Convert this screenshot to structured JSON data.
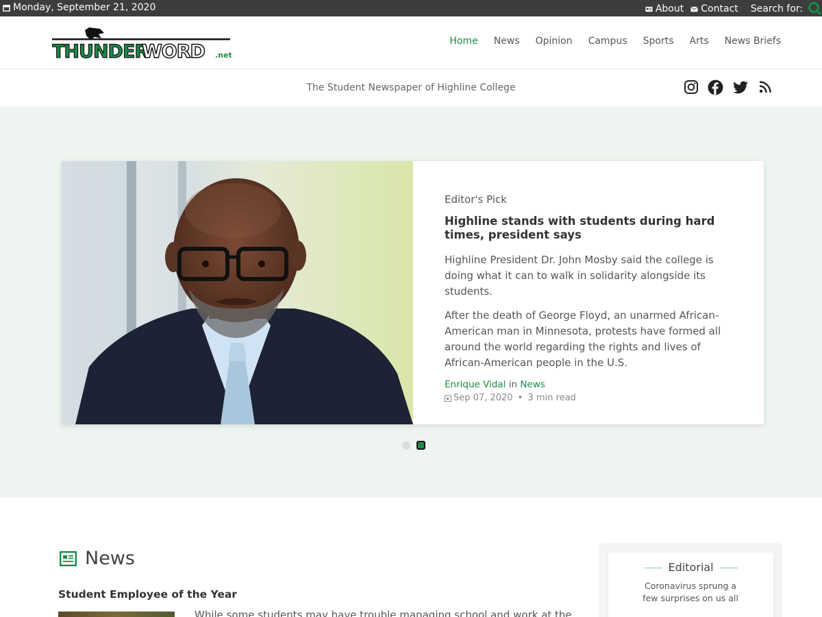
{
  "topbar": {
    "date": "Monday, September 21, 2020",
    "about": "About",
    "contact": "Contact",
    "search_label": "Search for:"
  },
  "header": {
    "logo_main": "THUNDERWORD",
    "logo_suffix": ".net",
    "nav": [
      "Home",
      "News",
      "Opinion",
      "Campus",
      "Sports",
      "Arts",
      "News Briefs"
    ],
    "active_nav": "Home"
  },
  "tagline": "The Student Newspaper of Highline College",
  "social": [
    "instagram-icon",
    "facebook-icon",
    "twitter-icon",
    "rss-icon"
  ],
  "hero": {
    "label": "Editor's Pick",
    "headline": "Highline stands with students during hard times, president says",
    "para1": "Highline President Dr. John Mosby said the college is doing what it can to walk in solidarity alongside its students.",
    "para2": "After the death of George Floyd, an unarmed African-American man in Minnesota, protests have formed all around the world regarding the rights and lives of African-American people in the U.S.",
    "author": "Enrique Vidal",
    "in_word": "in",
    "category": "News",
    "date": "Sep 07, 2020",
    "read_time": "3 min read",
    "carousel_total": 2,
    "carousel_active": 2
  },
  "news": {
    "section_title": "News",
    "story_title": "Student Employee of the Year",
    "story_snippet": "While some students may have trouble managing school and work at the same"
  },
  "sidebar": {
    "editorial_title": "Editorial",
    "editorial_text": "Coronavirus sprung a few surprises on us all"
  },
  "colors": {
    "accent": "#1a8a45",
    "topbar": "#3d3d3d",
    "hero_bg": "#eef5f0"
  }
}
